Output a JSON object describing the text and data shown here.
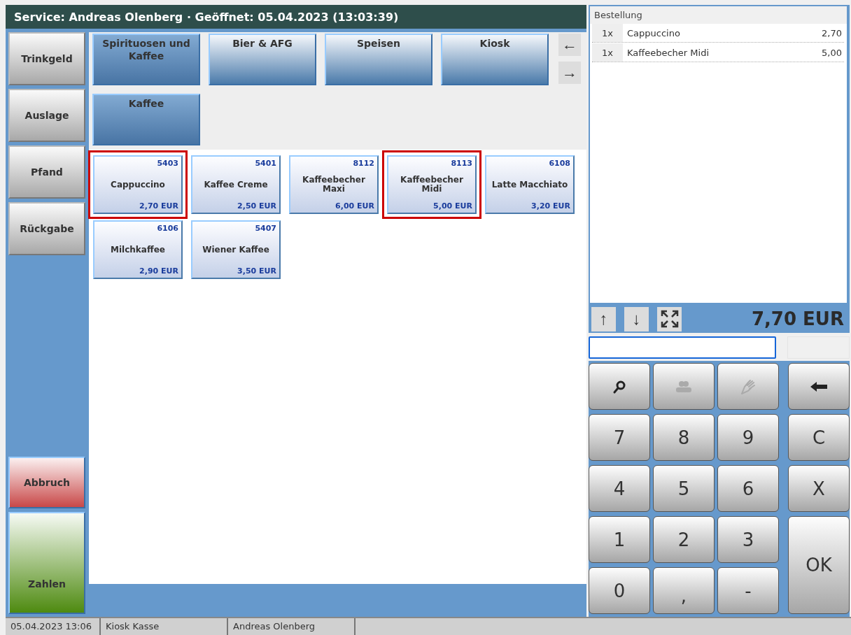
{
  "title": "Service: Andreas Olenberg · Geöffnet: 05.04.2023 (13:03:39)",
  "side_buttons": [
    {
      "label": "Trinkgeld",
      "kind": "neutral"
    },
    {
      "label": "Auslage",
      "kind": "neutral"
    },
    {
      "label": "Pfand",
      "kind": "neutral"
    },
    {
      "label": "Rückgabe",
      "kind": "neutral"
    },
    {
      "label": "Abbruch",
      "kind": "cancel"
    },
    {
      "label": "Zahlen",
      "kind": "pay"
    }
  ],
  "categories": [
    {
      "label": "Spirituosen und Kaffee",
      "selected": true
    },
    {
      "label": "Bier & AFG",
      "selected": false
    },
    {
      "label": "Speisen",
      "selected": false
    },
    {
      "label": "Kiosk",
      "selected": false
    }
  ],
  "category_nav": [
    "←",
    "→"
  ],
  "subcategories": [
    {
      "label": "Kaffee",
      "selected": true
    }
  ],
  "products": [
    {
      "code": "5403",
      "name": "Cappuccino",
      "price": "2,70 EUR",
      "highlighted": true
    },
    {
      "code": "5401",
      "name": "Kaffee Creme",
      "price": "2,50 EUR",
      "highlighted": false
    },
    {
      "code": "8112",
      "name": "Kaffeebecher Maxi",
      "price": "6,00 EUR",
      "highlighted": false
    },
    {
      "code": "8113",
      "name": "Kaffeebecher Midi",
      "price": "5,00 EUR",
      "highlighted": true
    },
    {
      "code": "6108",
      "name": "Latte Macchiato",
      "price": "3,20 EUR",
      "highlighted": false
    },
    {
      "code": "6106",
      "name": "Milchkaffee",
      "price": "2,90 EUR",
      "highlighted": false
    },
    {
      "code": "5407",
      "name": "Wiener Kaffee",
      "price": "3,50 EUR",
      "highlighted": false
    }
  ],
  "order": {
    "title": "Bestellung",
    "rows": [
      {
        "qty": "1x",
        "name": "Cappuccino",
        "price": "2,70"
      },
      {
        "qty": "1x",
        "name": "Kaffeebecher Midi",
        "price": "5,00"
      }
    ],
    "scroll_buttons": [
      "↑",
      "↓"
    ],
    "total": "7,70 EUR"
  },
  "keypad": [
    {
      "kind": "search",
      "disabled": false
    },
    {
      "kind": "people",
      "disabled": true
    },
    {
      "kind": "hand",
      "disabled": true
    },
    {
      "kind": "backspace",
      "disabled": false
    },
    {
      "kind": "text",
      "label": "7"
    },
    {
      "kind": "text",
      "label": "8"
    },
    {
      "kind": "text",
      "label": "9"
    },
    {
      "kind": "text",
      "label": "C"
    },
    {
      "kind": "text",
      "label": "4"
    },
    {
      "kind": "text",
      "label": "5"
    },
    {
      "kind": "text",
      "label": "6"
    },
    {
      "kind": "text",
      "label": "X"
    },
    {
      "kind": "text",
      "label": "1"
    },
    {
      "kind": "text",
      "label": "2"
    },
    {
      "kind": "text",
      "label": "3"
    },
    {
      "kind": "tall",
      "label": "OK"
    },
    {
      "kind": "text",
      "label": "0"
    },
    {
      "kind": "text",
      "label": ","
    },
    {
      "kind": "text",
      "label": "-"
    }
  ],
  "status_bar": [
    "05.04.2023 13:06",
    "Kiosk Kasse",
    "Andreas Olenberg"
  ]
}
